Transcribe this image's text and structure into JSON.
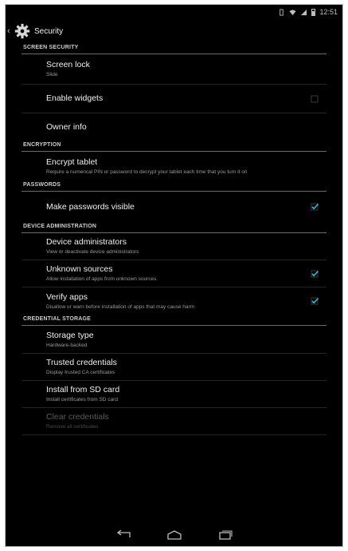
{
  "status_bar": {
    "time": "12:51"
  },
  "action_bar": {
    "title": "Security"
  },
  "sections": [
    {
      "header": "SCREEN SECURITY",
      "items": [
        {
          "title": "Screen lock",
          "summary": "Slide",
          "checkbox": null
        },
        {
          "title": "Enable widgets",
          "summary": "",
          "checkbox": false
        },
        {
          "title": "Owner info",
          "summary": "",
          "checkbox": null
        }
      ]
    },
    {
      "header": "ENCRYPTION",
      "items": [
        {
          "title": "Encrypt tablet",
          "summary": "Require a numerical PIN or password to decrypt your tablet each time that you turn it on",
          "checkbox": null
        }
      ]
    },
    {
      "header": "PASSWORDS",
      "items": [
        {
          "title": "Make passwords visible",
          "summary": "",
          "checkbox": true
        }
      ]
    },
    {
      "header": "DEVICE ADMINISTRATION",
      "items": [
        {
          "title": "Device administrators",
          "summary": "View or deactivate device administrators",
          "checkbox": null
        },
        {
          "title": "Unknown sources",
          "summary": "Allow installation of apps from unknown sources",
          "checkbox": true
        },
        {
          "title": "Verify apps",
          "summary": "Disallow or warn before installation of apps that may cause harm",
          "checkbox": true
        }
      ]
    },
    {
      "header": "CREDENTIAL STORAGE",
      "items": [
        {
          "title": "Storage type",
          "summary": "Hardware-backed",
          "checkbox": null
        },
        {
          "title": "Trusted credentials",
          "summary": "Display trusted CA certificates",
          "checkbox": null
        },
        {
          "title": "Install from SD card",
          "summary": "Install certificates from SD card",
          "checkbox": null
        },
        {
          "title": "Clear credentials",
          "summary": "Remove all certificates",
          "checkbox": null,
          "disabled": true
        }
      ]
    }
  ],
  "icons": {
    "app": "gear-icon",
    "up": "back-caret-icon",
    "nav_back": "back-arrow-icon",
    "nav_home": "home-icon",
    "nav_recents": "recent-apps-icon",
    "status_signal": "wifi-icon",
    "status_network": "cell-signal-icon",
    "status_vibrate": "vibrate-icon",
    "status_battery": "battery-icon"
  },
  "colors": {
    "background": "#000000",
    "accent": "#33b5e5",
    "text": "#f0f0f0",
    "secondary": "#9a9a9a"
  }
}
